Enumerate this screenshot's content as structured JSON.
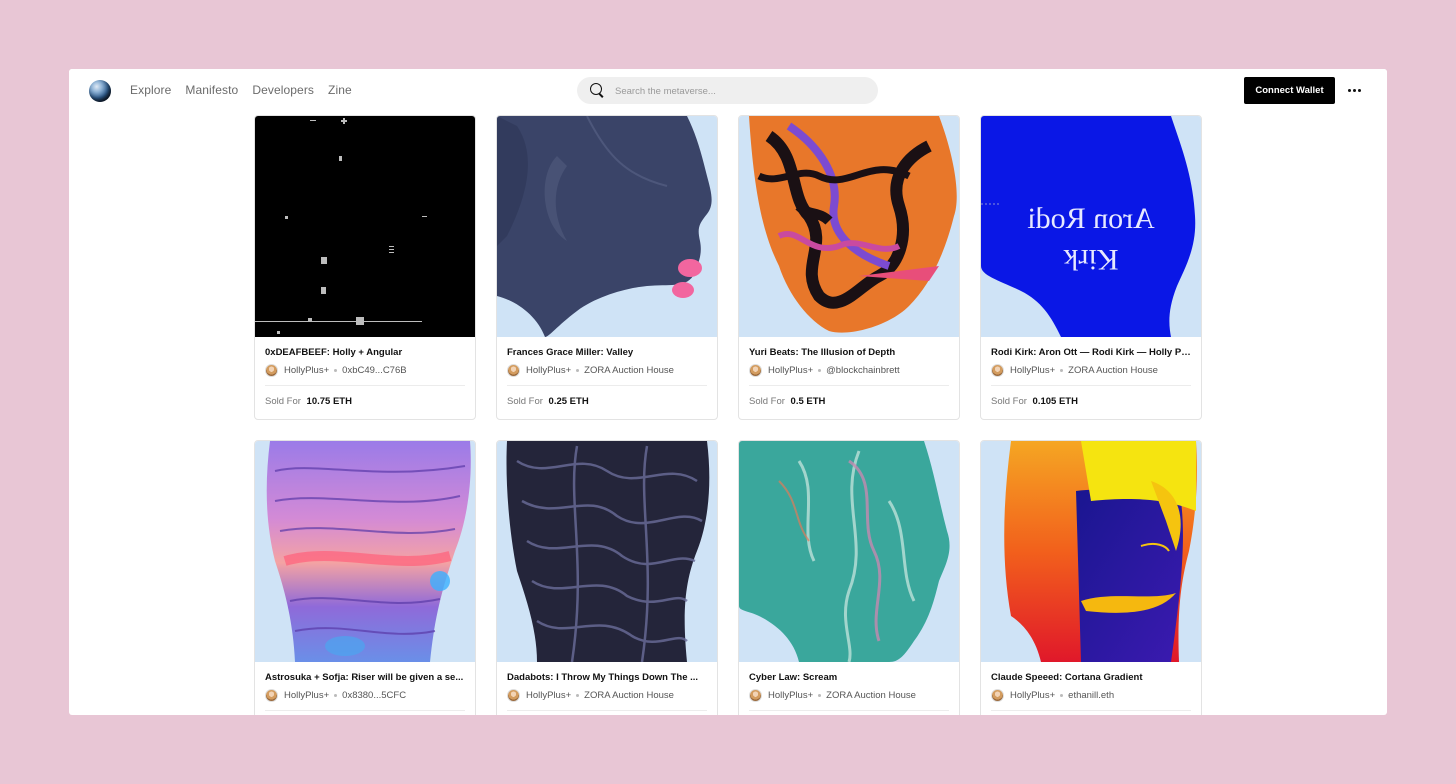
{
  "nav": {
    "links": [
      "Explore",
      "Manifesto",
      "Developers",
      "Zine"
    ]
  },
  "search": {
    "placeholder": "Search the metaverse..."
  },
  "header": {
    "connect_label": "Connect Wallet"
  },
  "cards": [
    {
      "title": "0xDEAFBEEF: Holly + Angular",
      "creator": "HollyPlus+",
      "owner": "0xbC49...C76B",
      "sold_label": "Sold For",
      "price": "10.75 ETH"
    },
    {
      "title": "Frances Grace Miller: Valley",
      "creator": "HollyPlus+",
      "owner": "ZORA Auction House",
      "sold_label": "Sold For",
      "price": "0.25 ETH"
    },
    {
      "title": "Yuri Beats: The Illusion of Depth",
      "creator": "HollyPlus+",
      "owner": "@blockchainbrett",
      "sold_label": "Sold For",
      "price": "0.5 ETH"
    },
    {
      "title": "Rodi Kirk: Aron Ott — Rodi Kirk — Holly Pl...",
      "creator": "HollyPlus+",
      "owner": "ZORA Auction House",
      "sold_label": "Sold For",
      "price": "0.105 ETH"
    },
    {
      "title": "Astrosuka + Sofja: Riser will be given a se...",
      "creator": "HollyPlus+",
      "owner": "0x8380...5CFC"
    },
    {
      "title": "Dadabots: I Throw My Things Down The ...",
      "creator": "HollyPlus+",
      "owner": "ZORA Auction House"
    },
    {
      "title": "Cyber Law: Scream",
      "creator": "HollyPlus+",
      "owner": "ZORA Auction House"
    },
    {
      "title": "Claude Speeed: Cortana Gradient",
      "creator": "HollyPlus+",
      "owner": "ethanill.eth"
    }
  ],
  "art_text": {
    "rodi_mirror": "Aron Rodi",
    "rodi_mirror_2": "Kirk"
  },
  "colors": {
    "page_bg": "#e8c6d5",
    "accent_button": "#000000",
    "card_sky": "#cfe3f6"
  }
}
